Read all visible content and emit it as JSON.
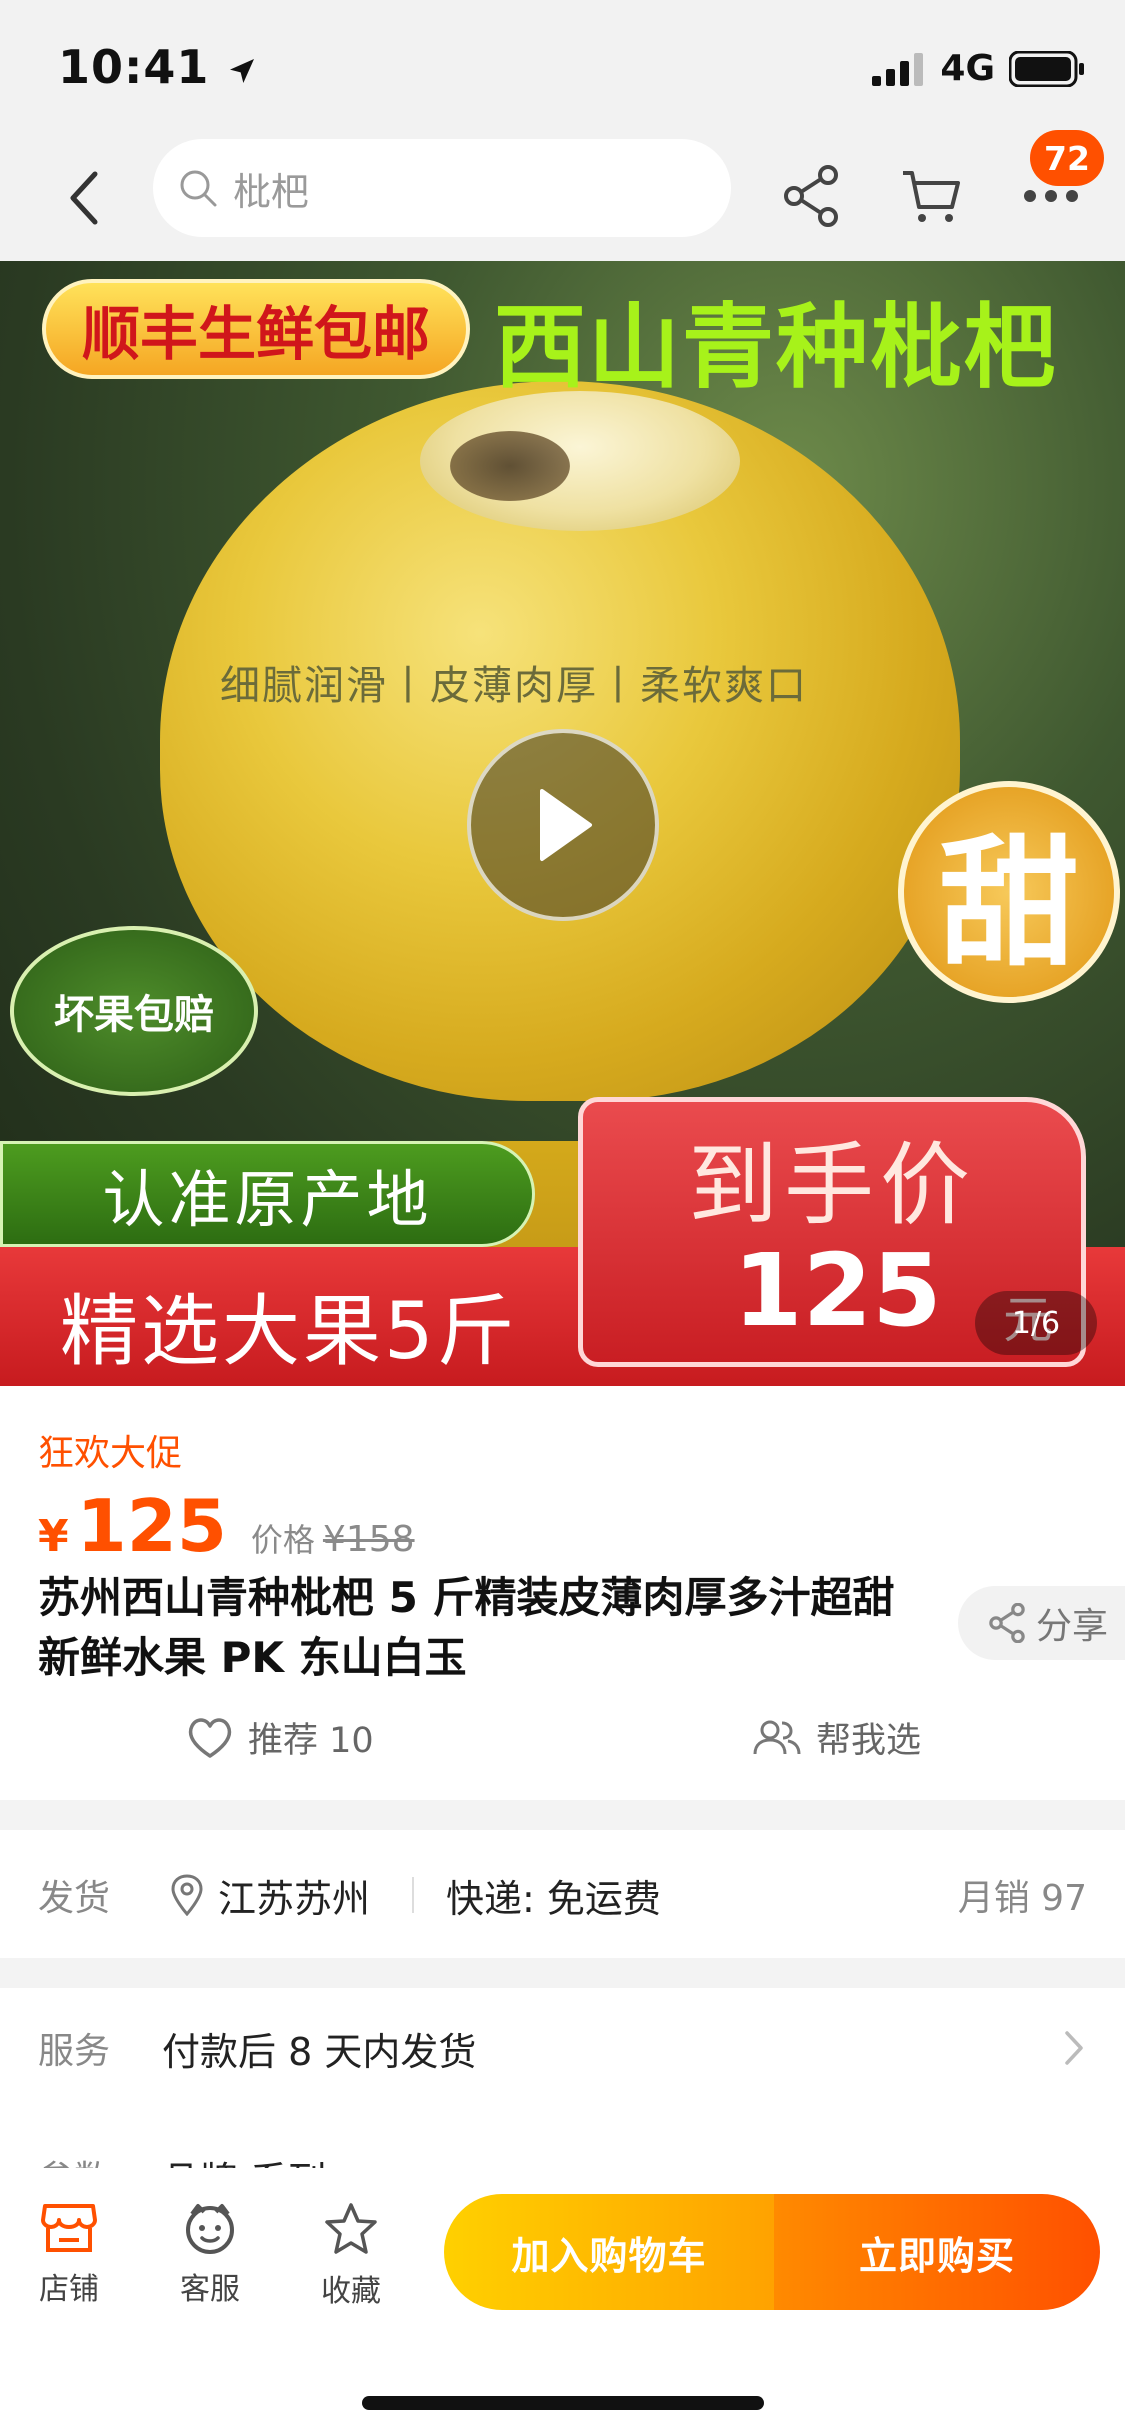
{
  "status_bar": {
    "time": "10:41",
    "network": "4G"
  },
  "nav": {
    "search_placeholder": "枇杷",
    "cart_badge": "72"
  },
  "hero": {
    "shipping_pill": "顺丰生鲜包邮",
    "title": "西山青种枇杷",
    "tagline": "细腻润滑丨皮薄肉厚丨柔软爽口",
    "sweet": "甜",
    "guarantee": "坏果包赔",
    "origin": "认准原产地",
    "bottom_text": "精选大果5斤",
    "price_label": "到手价",
    "price_value": "125",
    "price_unit": "元",
    "page_indicator": "1/6"
  },
  "product": {
    "promo_tag": "狂欢大促",
    "currency": "¥",
    "price": "125",
    "orig_label": "价格",
    "orig_price": "¥158",
    "title": "苏州西山青种枇杷 5 斤精装皮薄肉厚多汁超甜新鲜水果 PK 东山白玉",
    "share_label": "分享",
    "recommend_label": "推荐 10",
    "help_choose_label": "帮我选"
  },
  "shipping": {
    "label": "发货",
    "location": "江苏苏州",
    "method": "快递: 免运费",
    "monthly_sales": "月销 97"
  },
  "service": {
    "label": "服务",
    "value": "付款后 8 天内发货"
  },
  "params": {
    "label": "参数",
    "value": "品牌 系列"
  },
  "bottom_bar": {
    "store_label": "店铺",
    "service_label": "客服",
    "favorite_label": "收藏",
    "cart_label": "加入购物车",
    "buy_label": "立即购买"
  },
  "colors": {
    "accent": "#ff5000",
    "cart_gradient_start": "#ffd000",
    "buy_gradient_end": "#ff5000"
  }
}
